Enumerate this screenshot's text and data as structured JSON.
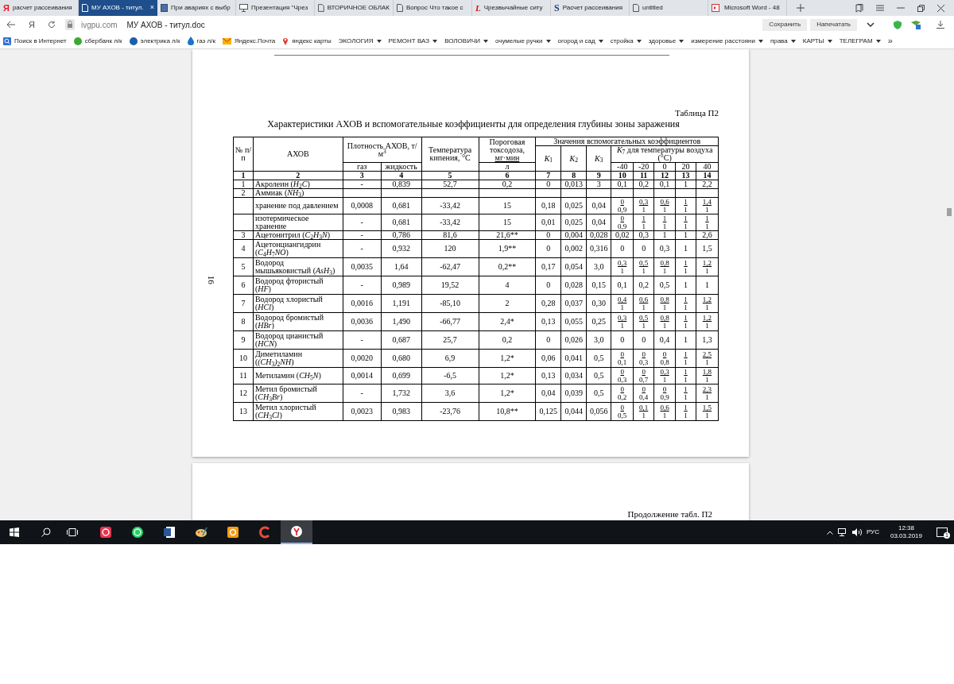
{
  "browser": {
    "tabs": [
      {
        "title": "расчет рассеивания",
        "kind": "yandex",
        "icon_text": "Я",
        "selected": false
      },
      {
        "title": "МУ АХОВ - титул.",
        "kind": "doc",
        "selected": true
      },
      {
        "title": "При авариях с выбр",
        "kind": "book",
        "selected": false
      },
      {
        "title": "Презентация \"Чрез",
        "kind": "slides",
        "selected": false
      },
      {
        "title": "ВТОРИЧНОЕ ОБЛАК",
        "kind": "doc",
        "selected": false
      },
      {
        "title": "Вопрос Что такое с",
        "kind": "doc",
        "selected": false
      },
      {
        "title": "Чрезвычайные ситу",
        "kind": "letter",
        "icon_text": "L",
        "selected": false
      },
      {
        "title": "Расчет рассеивания",
        "kind": "letter_s",
        "icon_text": "S",
        "selected": false
      },
      {
        "title": "untitled",
        "kind": "doc",
        "selected": false
      },
      {
        "title": "Microsoft Word - 48",
        "kind": "word",
        "selected": false
      }
    ],
    "tab_close": "×",
    "home_text": "Я",
    "domain": "ivgpu.com",
    "page_title": "МУ АХОВ - титул.doc",
    "actions": [
      "Сохранить",
      "Напечатать"
    ],
    "bookmarks": [
      {
        "label": "Поиск в Интернет",
        "kind": "search",
        "menu": false
      },
      {
        "label": "сбербанк л/к",
        "kind": "sber",
        "menu": false
      },
      {
        "label": "электрика л/к",
        "kind": "power",
        "menu": false
      },
      {
        "label": "газ л/к",
        "kind": "gas",
        "menu": false
      },
      {
        "label": "Яндекс.Почта",
        "kind": "mail",
        "menu": false
      },
      {
        "label": "яндекс карты",
        "kind": "pin",
        "menu": false
      },
      {
        "label": "ЭКОЛОГИЯ",
        "menu": true
      },
      {
        "label": "РЕМОНТ ВАЗ",
        "menu": true
      },
      {
        "label": "ВОЛОВИЧИ",
        "menu": true
      },
      {
        "label": "очумелые ручки",
        "menu": true
      },
      {
        "label": "огород и сад",
        "menu": true
      },
      {
        "label": "стройка",
        "menu": true
      },
      {
        "label": "здоровье",
        "menu": true
      },
      {
        "label": "измерение расстояни",
        "menu": true
      },
      {
        "label": "права",
        "menu": true
      },
      {
        "label": "КАРТЫ",
        "menu": true
      },
      {
        "label": "ТЕЛЕГРАМ",
        "menu": true
      }
    ],
    "more": "»"
  },
  "document": {
    "page_number": "16",
    "caption": "Таблица П2",
    "title": "Характеристики АХОВ и вспомогательные коэффициенты для определения глубины зоны заражения",
    "header": {
      "number": "№ п/п",
      "substance": "АХОВ",
      "density": "Плотность АХОВ, т/м$^{3}$",
      "density_gas": "газ",
      "density_liquid": "жидкость",
      "boiling": "Температура кипения, °С",
      "toxodose": "Пороговая токсодоза,",
      "toxodose_unit": [
        "мг·мин",
        "л"
      ],
      "coefficients": "Значения вспомогательных коэффициентов",
      "k": [
        "*K*$_{1}$",
        "*K*$_{2}$",
        "*K*$_{3}$"
      ],
      "k7": "*K*$_{7}$ для температуры воздуха (°С)",
      "temperatures": [
        "-40",
        "-20",
        "0",
        "20",
        "40"
      ]
    },
    "column_numbers": [
      "1",
      "2",
      "3",
      "4",
      "5",
      "6",
      "7",
      "8",
      "9",
      "10",
      "11",
      "12",
      "13",
      "14"
    ],
    "rows": [
      {
        "no": "1",
        "name": [
          "Акролеин (*H*$_{2}$*C*)"
        ],
        "cells": [
          "-",
          "0,839",
          "52,7",
          "0,2",
          "0",
          "0,013",
          "3",
          "0,1",
          "0,2",
          "0,1",
          "1",
          "2,2"
        ]
      },
      {
        "no": "2",
        "name": [
          "Аммиак (*NH*$_{3}$)"
        ]
      },
      {
        "name": [
          "хранение под давлением"
        ],
        "cells": [
          "0,0008",
          "0,681",
          "-33,42",
          "15",
          "0,18",
          "0,025",
          "0,04",
          [
            "0",
            "0,9"
          ],
          [
            "0,3",
            "1"
          ],
          [
            "0,6",
            "1"
          ],
          [
            "1",
            "1"
          ],
          [
            "1,4",
            "1"
          ]
        ]
      },
      {
        "name": [
          "изотермическое",
          "хранение"
        ],
        "cells": [
          "-",
          "0,681",
          "-33,42",
          "15",
          "0,01",
          "0,025",
          "0,04",
          [
            "0",
            "0,9"
          ],
          [
            "1",
            "1"
          ],
          [
            "1",
            "1"
          ],
          [
            "1",
            "1"
          ],
          [
            "1",
            "1"
          ]
        ]
      },
      {
        "no": "3",
        "name": [
          "Ацетонитрил (*C*$_{2}$*H*$_{3}$*N*)"
        ],
        "cells": [
          "-",
          "0,786",
          "81,6",
          "21,6**",
          "0",
          "0,004",
          "0,028",
          "0,02",
          "0,3",
          "1",
          "1",
          "2,6"
        ]
      },
      {
        "no": "4",
        "name": [
          "Ацетонциангидрин",
          "(*C*$_{4}$*H*$_{7}$*NO*)"
        ],
        "cells": [
          "-",
          "0,932",
          "120",
          "1,9**",
          "0",
          "0,002",
          "0,316",
          "0",
          "0",
          "0,3",
          "1",
          "1,5"
        ]
      },
      {
        "no": "5",
        "name": [
          "Водород",
          "мышьяковистый (*AsH*$_{3}$)"
        ],
        "cells": [
          "0,0035",
          "1,64",
          "-62,47",
          "0,2**",
          "0,17",
          "0,054",
          "3,0",
          [
            "0,3",
            "1"
          ],
          [
            "0,5",
            "1"
          ],
          [
            "0,8",
            "1"
          ],
          [
            "1",
            "1"
          ],
          [
            "1,2",
            "1"
          ]
        ]
      },
      {
        "no": "6",
        "name": [
          "Водород фтористый",
          "(*HF*)"
        ],
        "cells": [
          "-",
          "0,989",
          "19,52",
          "4",
          "0",
          "0,028",
          "0,15",
          "0,1",
          "0,2",
          "0,5",
          "1",
          "1"
        ]
      },
      {
        "no": "7",
        "name": [
          "Водород хлористый",
          "(*HCl*)"
        ],
        "cells": [
          "0,0016",
          "1,191",
          "-85,10",
          "2",
          "0,28",
          "0,037",
          "0,30",
          [
            "0,4",
            "1"
          ],
          [
            "0,6",
            "1"
          ],
          [
            "0,8",
            "1"
          ],
          [
            "1",
            "1"
          ],
          [
            "1,2",
            "1"
          ]
        ]
      },
      {
        "no": "8",
        "name": [
          "Водород бромистый",
          "(*HBr*)"
        ],
        "cells": [
          "0,0036",
          "1,490",
          "-66,77",
          "2,4*",
          "0,13",
          "0,055",
          "0,25",
          [
            "0,3",
            "1"
          ],
          [
            "0,5",
            "1"
          ],
          [
            "0,8",
            "1"
          ],
          [
            "1",
            "1"
          ],
          [
            "1,2",
            "1"
          ]
        ]
      },
      {
        "no": "9",
        "name": [
          "Водород цианистый",
          "(*HCN*)"
        ],
        "cells": [
          "-",
          "0,687",
          "25,7",
          "0,2",
          "0",
          "0,026",
          "3,0",
          "0",
          "0",
          "0,4",
          "1",
          "1,3"
        ]
      },
      {
        "no": "10",
        "name": [
          "Диметиламин",
          "(*(CH*$_{3}$*)*$_{2}$*NH*)"
        ],
        "cells": [
          "0,0020",
          "0,680",
          "6,9",
          "1,2*",
          "0,06",
          "0,041",
          "0,5",
          [
            "0",
            "0,1"
          ],
          [
            "0",
            "0,3"
          ],
          [
            "0",
            "0,8"
          ],
          [
            "1",
            "1"
          ],
          [
            "2,5",
            "1"
          ]
        ]
      },
      {
        "no": "11",
        "name": [
          "Метиламин (*CH*$_{5}$*N*)"
        ],
        "cells": [
          "0,0014",
          "0,699",
          "-6,5",
          "1,2*",
          "0,13",
          "0,034",
          "0,5",
          [
            "0",
            "0,3"
          ],
          [
            "0",
            "0,7"
          ],
          [
            "0,3",
            "1"
          ],
          [
            "1",
            "1"
          ],
          [
            "1,8",
            "1"
          ]
        ]
      },
      {
        "no": "12",
        "name": [
          "Метил бромистый",
          "(*CH*$_{3}$*Br*)"
        ],
        "cells": [
          "-",
          "1,732",
          "3,6",
          "1,2*",
          "0,04",
          "0,039",
          "0,5",
          [
            "0",
            "0,2"
          ],
          [
            "0",
            "0,4"
          ],
          [
            "0",
            "0,9"
          ],
          [
            "1",
            "1"
          ],
          [
            "2,3",
            "1"
          ]
        ]
      },
      {
        "no": "13",
        "name": [
          "Метил хлористый",
          "(*CH*$_{3}$*Cl*)"
        ],
        "cells": [
          "0,0023",
          "0,983",
          "-23,76",
          "10,8**",
          "0,125",
          "0,044",
          "0,056",
          [
            "0",
            "0,5"
          ],
          [
            "0,1",
            "1"
          ],
          [
            "0,6",
            "1"
          ],
          [
            "1",
            "1"
          ],
          [
            "1,5",
            "1"
          ]
        ]
      }
    ],
    "next_caption": "Продолжение табл. П2"
  },
  "taskbar": {
    "apps": [
      {
        "kind": "red",
        "active": false
      },
      {
        "kind": "whatsapp",
        "active": false
      },
      {
        "kind": "word",
        "active": false
      },
      {
        "kind": "paint",
        "active": false
      },
      {
        "kind": "orange",
        "active": false
      },
      {
        "kind": "ccleaner",
        "active": false
      },
      {
        "kind": "yandex",
        "active": true
      }
    ],
    "language": "РУС",
    "time": "12:38",
    "date": "03.03.2019",
    "notifications": "1"
  }
}
